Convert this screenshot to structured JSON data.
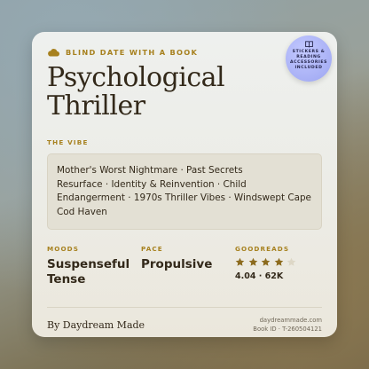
{
  "header": {
    "tag": "BLIND DATE WITH A BOOK",
    "icon": "cloud-icon",
    "title_lines": [
      "Psychological",
      "Thriller"
    ]
  },
  "badge": {
    "icon": "book-icon",
    "lines": [
      "STICKERS &",
      "READING",
      "ACCESSORIES",
      "INCLUDED"
    ]
  },
  "vibe": {
    "label": "THE VIBE",
    "lines": [
      "Mother's Worst Nightmare · Past Secrets",
      "Resurface · Identity & Reinvention · Child",
      "Endangerment · 1970s Thriller Vibes · Windswept Cape",
      "Cod Haven"
    ]
  },
  "moods": {
    "label": "MOODS",
    "values": [
      "Suspenseful",
      "Tense"
    ]
  },
  "pace": {
    "label": "PACE",
    "value": "Propulsive"
  },
  "goodreads": {
    "label": "GOODREADS",
    "stars_filled": 4,
    "stars_total": 5,
    "rating_text": "4.04 · 62K"
  },
  "footer": {
    "by": "By Daydream Made",
    "site": "daydreammade.com",
    "book_id": "Book ID · T-260504121"
  },
  "colors": {
    "accent": "#a7811f",
    "text": "#33291a",
    "badge": "#a8b0f5",
    "star_filled": "#8c6b1e",
    "star_empty": "#ddd7c6"
  }
}
